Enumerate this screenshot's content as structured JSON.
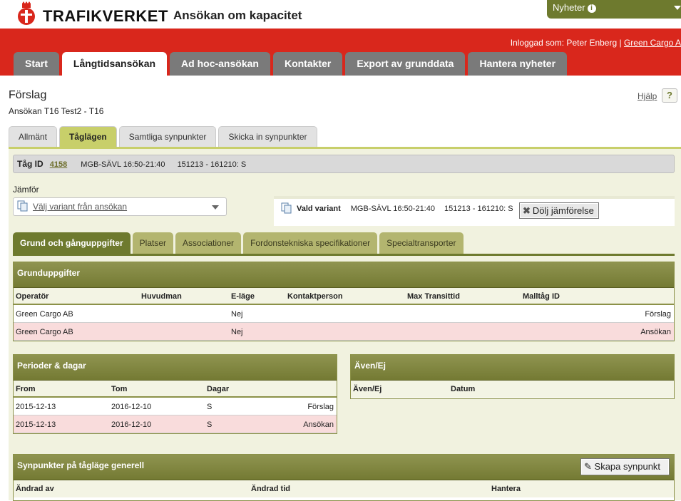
{
  "header": {
    "brand": "TRAFIKVERKET",
    "app_title": "Ansökan om kapacitet",
    "news_label": "Nyheter",
    "login_prefix": "Inloggad som: Peter Enberg |",
    "login_company": "Green Cargo A"
  },
  "main_tabs": [
    "Start",
    "Långtidsansökan",
    "Ad hoc-ansökan",
    "Kontakter",
    "Export av grunddata",
    "Hantera nyheter"
  ],
  "page": {
    "title": "Förslag",
    "subtitle": "Ansökan T16 Test2 - T16",
    "help_label": "Hjälp",
    "help_q": "?"
  },
  "sub_tabs": [
    "Allmänt",
    "Taglägen",
    "Samtliga synpunkter",
    "Skicka in synpunkter"
  ],
  "train": {
    "label": "Tåg ID",
    "id": "4158",
    "route": "MGB-SÄVL 16:50-21:40",
    "period": "151213 - 161210: S"
  },
  "compare": {
    "label": "Jämför",
    "select_text": "Välj variant från ansökan",
    "variant_label": "Vald variant",
    "variant_route": "MGB-SÄVL 16:50-21:40",
    "variant_period": "151213 - 161210: S",
    "hide_button": "Dölj jämförelse"
  },
  "section_tabs": [
    "Grund och gånguppgifter",
    "Platser",
    "Associationer",
    "Fordonstekniska specifikationer",
    "Specialtransporter"
  ],
  "grund": {
    "title": "Grunduppgifter",
    "columns": [
      "Operatör",
      "Huvudman",
      "E-läge",
      "Kontaktperson",
      "Max Transittid",
      "Malltåg ID"
    ],
    "rows": [
      {
        "operator": "Green Cargo AB",
        "elage": "Nej",
        "type": "Förslag"
      },
      {
        "operator": "Green Cargo AB",
        "elage": "Nej",
        "type": "Ansökan"
      }
    ]
  },
  "perioder": {
    "title": "Perioder & dagar",
    "columns": [
      "From",
      "Tom",
      "Dagar"
    ],
    "rows": [
      {
        "from": "2015-12-13",
        "tom": "2016-12-10",
        "dagar": "S",
        "type": "Förslag"
      },
      {
        "from": "2015-12-13",
        "tom": "2016-12-10",
        "dagar": "S",
        "type": "Ansökan"
      }
    ]
  },
  "aven": {
    "title": "Även/Ej",
    "columns": [
      "Även/Ej",
      "Datum"
    ]
  },
  "synpunkter": {
    "title": "Synpunkter på tågläge generell",
    "create_button": "Skapa synpunkt",
    "columns": [
      "Ändrad av",
      "Ändrad tid",
      "Hantera"
    ]
  },
  "colors": {
    "brand_red": "#d9271c",
    "olive": "#6e7a2e",
    "active_subtab": "#c8cf6a",
    "pink_row": "#f9dcdc"
  }
}
